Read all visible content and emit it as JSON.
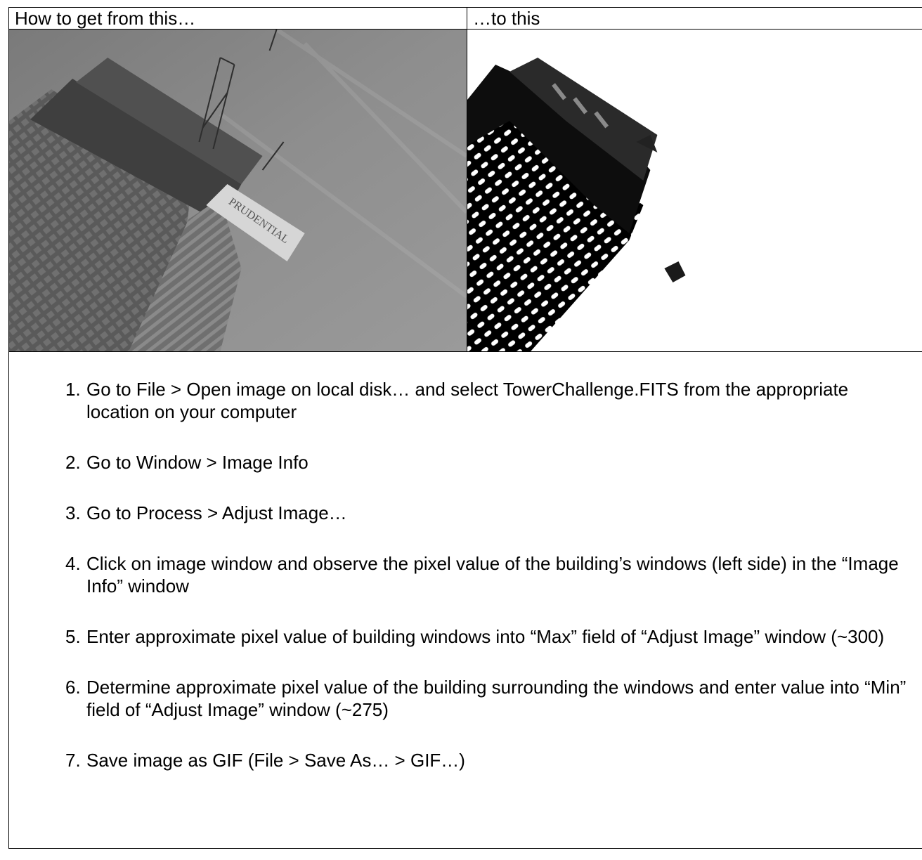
{
  "table": {
    "header_left": "How to get from this…",
    "header_right": "…to this"
  },
  "images": {
    "before_text": "PRUDENTIAL"
  },
  "steps": [
    {
      "num": "1.",
      "text": "Go to File > Open image on local disk… and select TowerChallenge.FITS from the appropriate location on your computer"
    },
    {
      "num": "2.",
      "text": "Go to Window > Image Info"
    },
    {
      "num": "3.",
      "text": "Go to Process > Adjust Image…"
    },
    {
      "num": "4.",
      "text": "Click on image window and observe the pixel value of the building’s windows (left side) in the “Image Info” window"
    },
    {
      "num": "5.",
      "text": "Enter approximate pixel value of building windows into “Max” field of “Adjust Image” window (~300)"
    },
    {
      "num": "6.",
      "text": "Determine approximate pixel value of the building surrounding the windows and enter value into “Min” field of “Adjust Image” window (~275)"
    },
    {
      "num": "7.",
      "text": "Save image as GIF (File > Save As… > GIF…)"
    }
  ]
}
